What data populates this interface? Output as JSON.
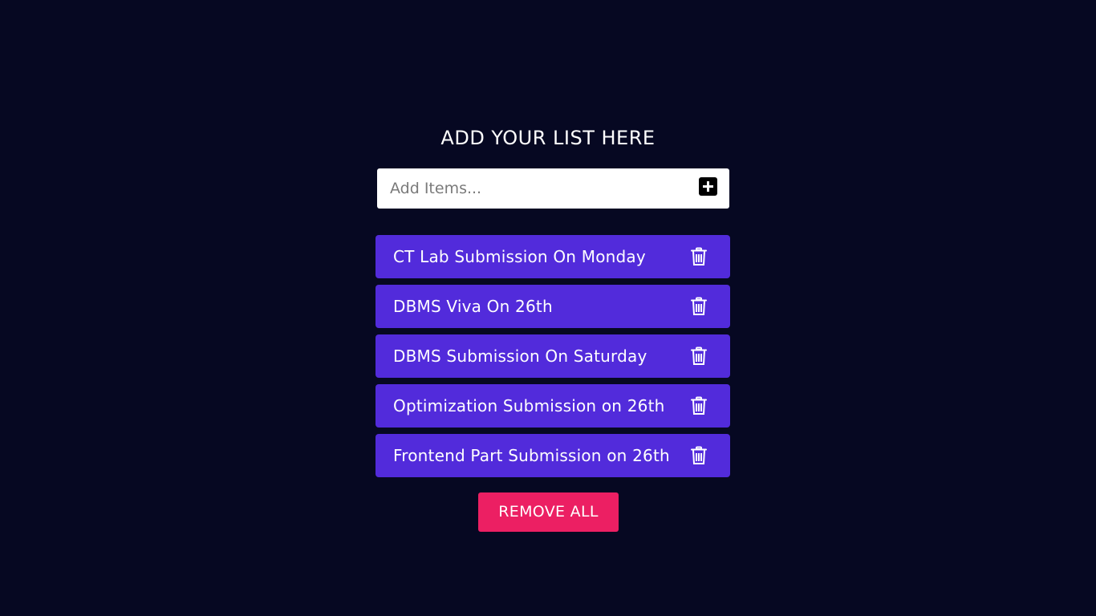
{
  "heading": "ADD YOUR LIST HERE",
  "input": {
    "placeholder": "Add Items...",
    "value": ""
  },
  "add_button": {
    "icon": "plus-icon"
  },
  "items": [
    {
      "text": "CT Lab Submission On Monday",
      "icon": "trash-icon"
    },
    {
      "text": "DBMS Viva On 26th",
      "icon": "trash-icon"
    },
    {
      "text": "DBMS Submission On Saturday",
      "icon": "trash-icon"
    },
    {
      "text": "Optimization Submission on 26th",
      "icon": "trash-icon"
    },
    {
      "text": "Frontend Part Submission on 26th",
      "icon": "trash-icon"
    }
  ],
  "remove_all_label": "REMOVE ALL",
  "colors": {
    "background": "#060822",
    "item_background": "#522bdb",
    "remove_button": "#ec1f63",
    "text": "#ffffff"
  }
}
